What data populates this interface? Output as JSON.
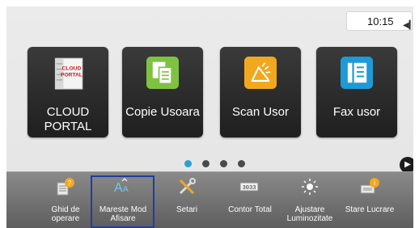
{
  "status": {
    "time": "10:15"
  },
  "apps": [
    {
      "label": "CLOUD PORTAL",
      "icon": "cloud-portal-icon",
      "logo_text": "CLOUD\nPORTAL"
    },
    {
      "label": "Copie Usoara",
      "icon": "copy-icon"
    },
    {
      "label": "Scan Usor",
      "icon": "scan-icon"
    },
    {
      "label": "Fax usor",
      "icon": "fax-icon"
    }
  ],
  "pagination": {
    "pages": 4,
    "current": 1
  },
  "bottom_bar": [
    {
      "label": "Ghid de operare",
      "icon": "guide-book-icon"
    },
    {
      "label": "Mareste Mod Afisare",
      "icon": "enlarge-text-icon",
      "selected": true
    },
    {
      "label": "Setari",
      "icon": "settings-tools-icon"
    },
    {
      "label": "Contor Total",
      "icon": "counter-icon"
    },
    {
      "label": "Ajustare Luminozitate",
      "icon": "brightness-icon"
    },
    {
      "label": "Stare Lucrare",
      "icon": "job-status-icon"
    }
  ],
  "colors": {
    "accent_blue": "#1f3da0",
    "dot_active": "#2aa0d8"
  }
}
